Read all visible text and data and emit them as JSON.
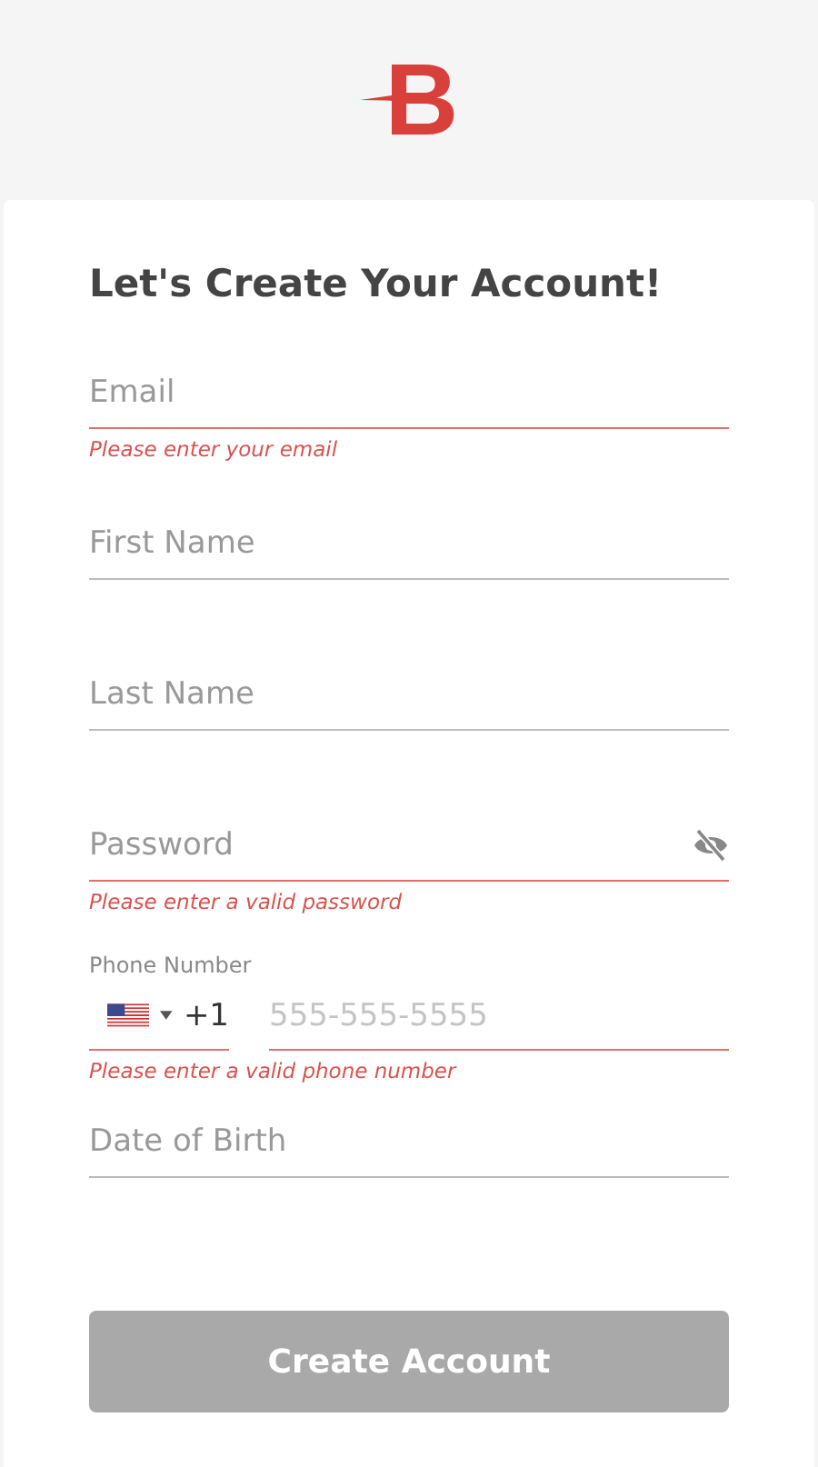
{
  "logo": {
    "text": "B"
  },
  "title": "Let's Create Your Account!",
  "fields": [
    {
      "kind": "text",
      "placeholder": "Email",
      "invalid": true,
      "error": "Please enter your email"
    },
    {
      "kind": "text",
      "placeholder": "First Name",
      "invalid": false
    },
    {
      "kind": "text",
      "placeholder": "Last Name",
      "invalid": false
    },
    {
      "kind": "password",
      "placeholder": "Password",
      "invalid": true,
      "error": "Please enter a valid password",
      "visible": false
    },
    {
      "kind": "phone",
      "label": "Phone Number",
      "code": "+1",
      "placeholder": "555-555-5555",
      "invalid": true,
      "error": "Please enter a valid phone number"
    },
    {
      "kind": "text",
      "placeholder": "Date of Birth",
      "invalid": false
    }
  ],
  "button": {
    "label": "Create Account",
    "disabled": true
  }
}
